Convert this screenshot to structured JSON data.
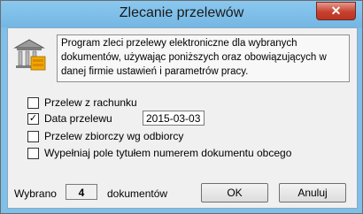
{
  "window": {
    "title": "Zlecanie przelewów",
    "close_label": "✕"
  },
  "info": {
    "text": "Program zleci przelewy elektroniczne dla wybranych dokumentów, używając poniższych oraz obowiązujących w danej firmie ustawień i parametrów pracy.",
    "icon": "bank-icon"
  },
  "options": [
    {
      "label": "Przelew z rachunku",
      "checked": false
    },
    {
      "label": "Data przelewu",
      "checked": true
    },
    {
      "label": "Przelew zbiorczy wg odbiorcy",
      "checked": false
    },
    {
      "label": "Wypełniaj pole tytułem numerem dokumentu obcego",
      "checked": false
    }
  ],
  "date_value": "2015-03-03",
  "summary": {
    "prefix": "Wybrano",
    "count": "4",
    "suffix": "dokumentów"
  },
  "buttons": {
    "ok": "OK",
    "cancel": "Anuluj"
  }
}
